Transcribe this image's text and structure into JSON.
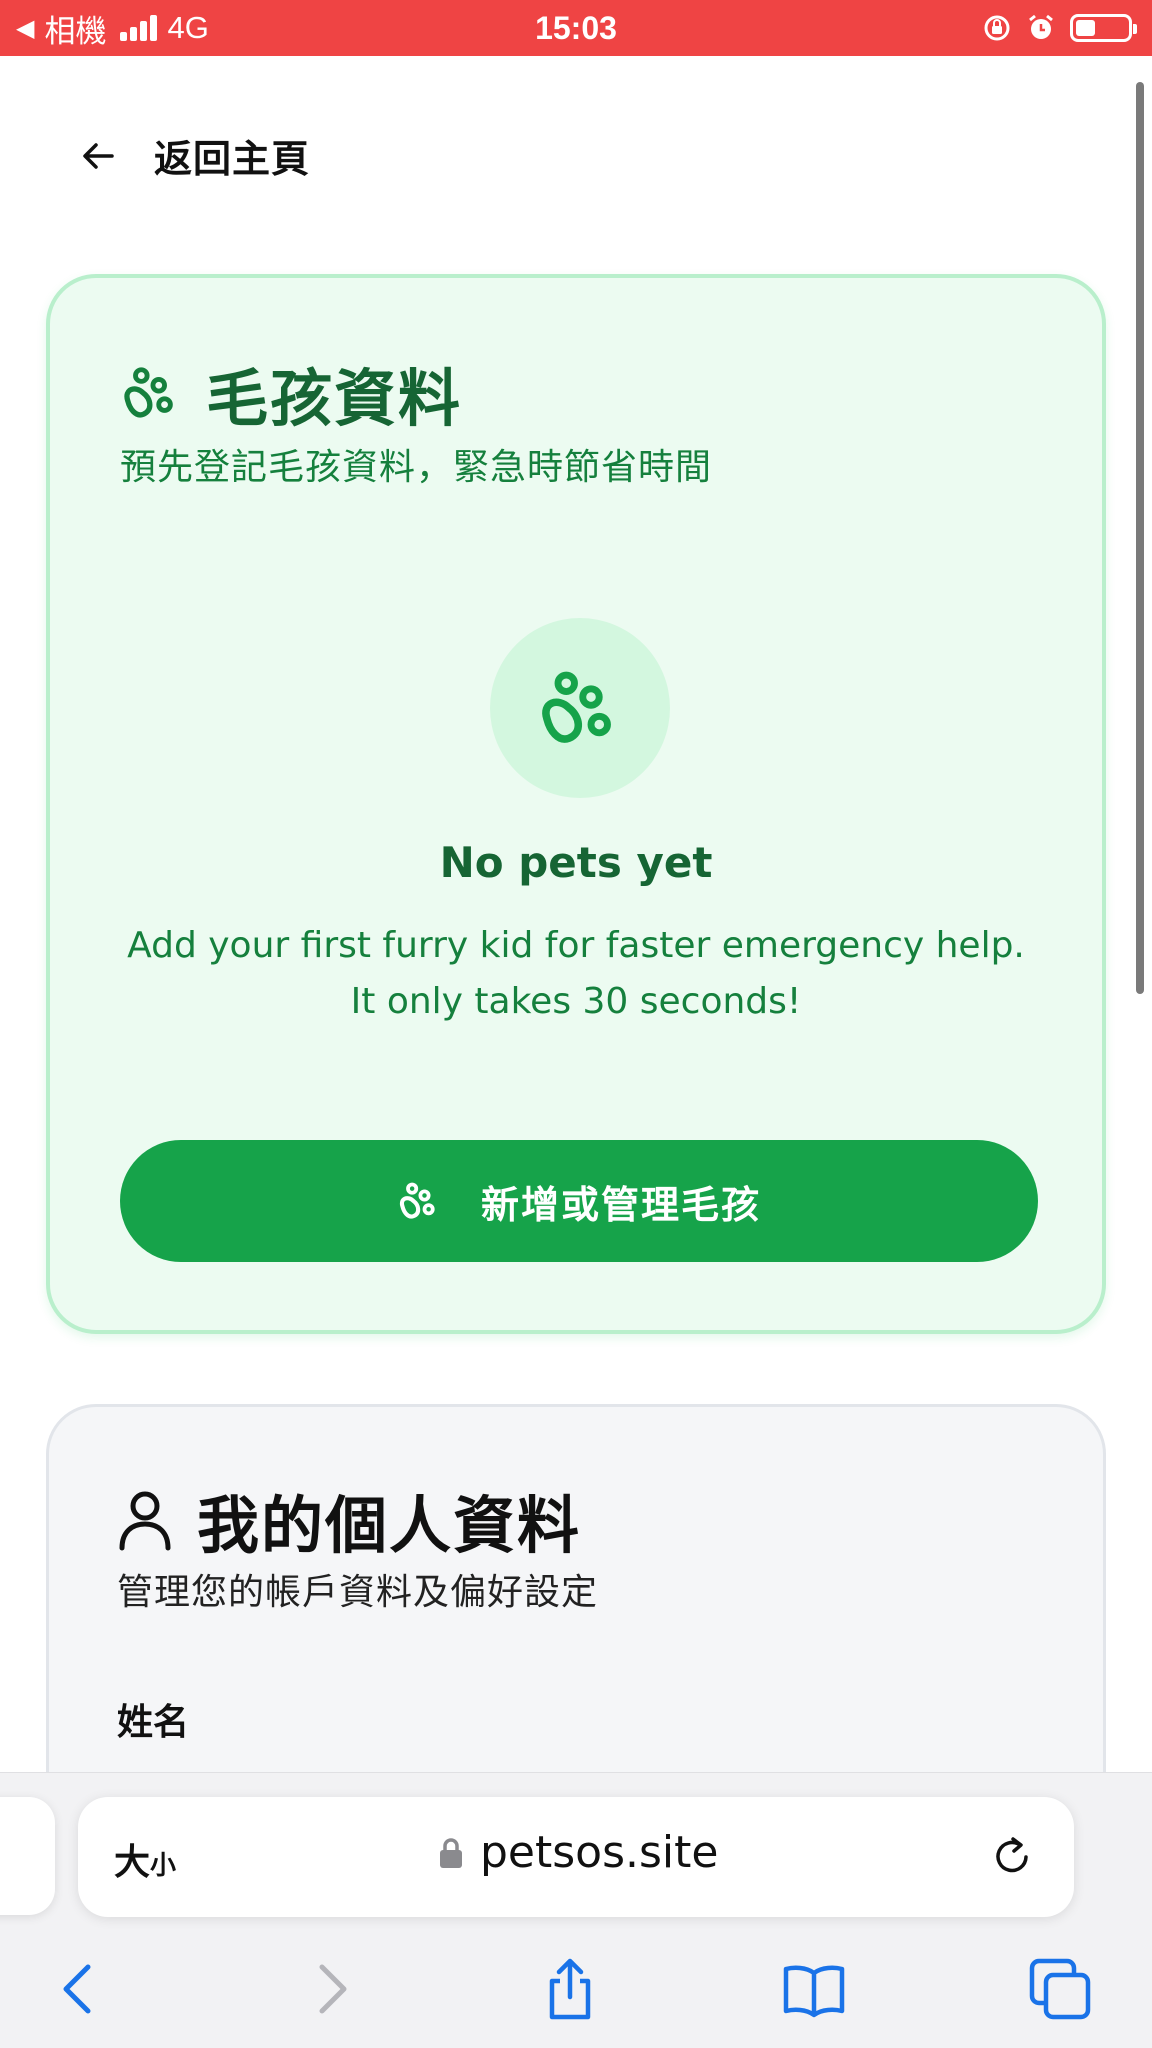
{
  "status_bar": {
    "back_app": "相機",
    "network": "4G",
    "time": "15:03",
    "battery_level": 0.38
  },
  "nav": {
    "back_label": "返回主頁"
  },
  "pet_card": {
    "title": "毛孩資料",
    "subtitle": "預先登記毛孩資料，緊急時節省時間",
    "empty_title": "No pets yet",
    "empty_desc_line1": "Add your first furry kid for faster emergency help.",
    "empty_desc_line2": "It only takes 30 seconds!",
    "button_label": "新增或管理毛孩",
    "icon": "paw-icon"
  },
  "profile_card": {
    "title": "我的個人資料",
    "subtitle": "管理您的帳戶資料及偏好設定",
    "field_name_label": "姓名",
    "icon": "user-icon"
  },
  "browser": {
    "text_size_big": "大",
    "text_size_small": "小",
    "url": "petsos.site",
    "toolbar": [
      "back-icon",
      "forward-icon",
      "share-icon",
      "bookmarks-icon",
      "tabs-icon"
    ]
  },
  "colors": {
    "status_bar": "#ef4444",
    "pet_accent": "#16a34a",
    "pet_card_bg": "#ecfbf1",
    "browser_blue": "#1a73e8"
  }
}
